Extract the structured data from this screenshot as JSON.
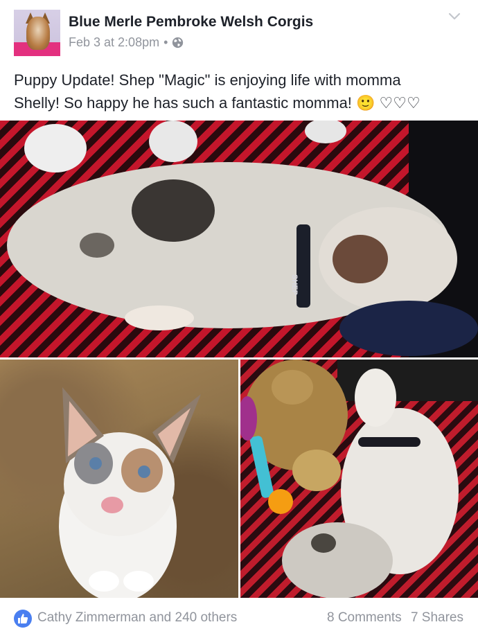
{
  "post": {
    "page_name": "Blue Merle Pembroke Welsh Corgis",
    "timestamp": "Feb 3 at 2:08pm",
    "separator": "•",
    "privacy_icon": "globe-icon",
    "menu_icon": "chevron-down-icon",
    "text_line1": "Puppy Update!  Shep \"Magic\" is enjoying life with momma",
    "text_line2": "Shelly! So happy he has such a fantastic momma! 🙂 ♡♡♡"
  },
  "photos": [
    {
      "name": "corgi-sleeping-photo",
      "collar_text": "SHEP"
    },
    {
      "name": "corgi-puppy-portrait-photo"
    },
    {
      "name": "corgi-with-teddy-photo"
    }
  ],
  "footer": {
    "like_icon": "thumbs-up-icon",
    "reactors": "Cathy Zimmerman and 240 others",
    "comments": "8 Comments",
    "shares": "7 Shares"
  },
  "colors": {
    "text_primary": "#1d2129",
    "text_secondary": "#90949c",
    "like_blue": "#4a7ff0"
  }
}
